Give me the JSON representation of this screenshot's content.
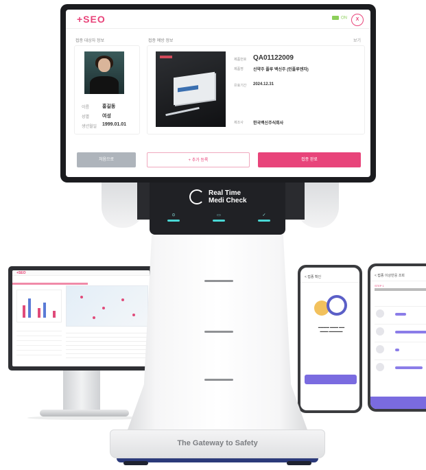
{
  "kiosk": {
    "logo": "+SEO",
    "status": "ON",
    "close_label": "X",
    "left_section_title": "접종 대상자 정보",
    "right_section_title": "접종 예방 정보",
    "right_link": "보기",
    "person": {
      "name_key": "이름",
      "name_value": "홍길동",
      "gender_key": "성별",
      "gender_value": "여성",
      "birth_key": "생년월일",
      "birth_value": "1999.01.01"
    },
    "product": {
      "code_key": "제품번호",
      "code_value": "QA01122009",
      "name_key": "제품명",
      "name_value": "신약주 플루 백신주 (인플루엔자)",
      "date_key": "유효기간",
      "date_value": "2024.12.31",
      "maker_key": "제조사",
      "maker_value": "한국백신주식회사"
    },
    "buttons": {
      "cancel": "처음으로",
      "add": "+ 추가 등록",
      "confirm": "접종 완료"
    },
    "brand_line1": "Real Time",
    "brand_line2": "Medi Check",
    "led_labels": [
      "⊙",
      "▭",
      "✓"
    ],
    "tagline": "The Gateway to Safety"
  },
  "monitor": {
    "logo": "+SEO"
  },
  "phone1": {
    "title": "< 접종 확인"
  },
  "phone2": {
    "title": "< 접종 이상반응 조회",
    "label": "STEP 1"
  },
  "colors": {
    "accent_pink": "#e8447a",
    "led_cyan": "#49d8d5",
    "phone_purple": "#7a6be0"
  }
}
